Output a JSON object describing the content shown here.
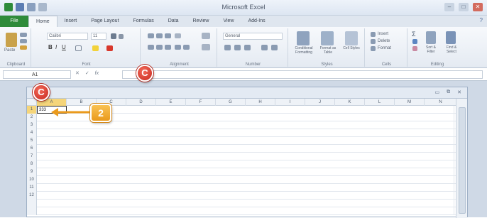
{
  "window": {
    "title": "Microsoft Excel"
  },
  "ribbon_tabs": [
    {
      "label": "File"
    },
    {
      "label": "Home"
    },
    {
      "label": "Insert"
    },
    {
      "label": "Page Layout"
    },
    {
      "label": "Formulas"
    },
    {
      "label": "Data"
    },
    {
      "label": "Review"
    },
    {
      "label": "View"
    },
    {
      "label": "Add-Ins"
    }
  ],
  "ribbon": {
    "font_name": "Calibri",
    "font_size": "11",
    "number_format": "General",
    "groups": [
      "Clipboard",
      "Font",
      "Alignment",
      "Number",
      "Styles",
      "Cells",
      "Editing"
    ],
    "styles_labels": [
      "Conditional Formatting",
      "Format as Table",
      "Cell Styles"
    ],
    "cells_labels": [
      "Insert",
      "Delete",
      "Format"
    ],
    "editing_labels": [
      "Sort & Filter",
      "Find & Select"
    ],
    "paste_label": "Paste"
  },
  "formula_bar": {
    "name_box": "A1",
    "fx_label": "fx",
    "value": ""
  },
  "sheet": {
    "columns": [
      "A",
      "B",
      "C",
      "D",
      "E",
      "F",
      "G",
      "H",
      "I",
      "J",
      "K",
      "L",
      "M",
      "N"
    ],
    "rows": [
      "1",
      "2",
      "3",
      "4",
      "5",
      "6",
      "7",
      "8",
      "9",
      "10",
      "11",
      "12"
    ],
    "cell_a1": "333"
  },
  "callouts": {
    "c_label": "C",
    "step_label": "2"
  },
  "colors": {
    "file_tab": "#2e8b3a",
    "callout_c": "#d9362a",
    "callout_step": "#f0a42a",
    "selected_header": "#f5d57a"
  }
}
